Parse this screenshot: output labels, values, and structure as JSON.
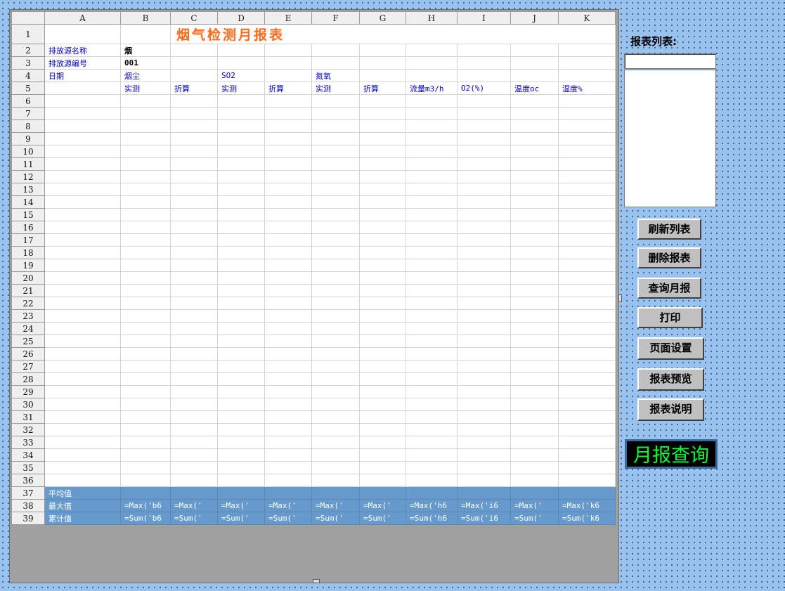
{
  "spreadsheet": {
    "columns": [
      "A",
      "B",
      "C",
      "D",
      "E",
      "F",
      "G",
      "H",
      "I",
      "J",
      "K"
    ],
    "title": "烟气检测月报表",
    "row2": {
      "label": "排放源名称",
      "value": "烟"
    },
    "row3": {
      "label": "排放源编号",
      "value": "001"
    },
    "row4": {
      "date": "日期",
      "dust": "烟尘",
      "so2": "SO2",
      "nox": "氮氧"
    },
    "row5": [
      "实测",
      "折算",
      "实测",
      "折算",
      "实测",
      "折算",
      "流量m3/h",
      "O2(%)",
      "温度oc",
      "湿度%"
    ],
    "row_numbers": [
      "1",
      "2",
      "3",
      "4",
      "5",
      "6",
      "7",
      "8",
      "9",
      "10",
      "11",
      "12",
      "13",
      "14",
      "15",
      "16",
      "17",
      "18",
      "19",
      "20",
      "21",
      "22",
      "23",
      "24",
      "25",
      "26",
      "27",
      "28",
      "29",
      "30",
      "31",
      "32",
      "33",
      "34",
      "35",
      "36",
      "37",
      "38",
      "39"
    ],
    "summary_rows": [
      {
        "label": "平均值",
        "cells": [
          "",
          "",
          "",
          "",
          "",
          "",
          "",
          "",
          "",
          ""
        ]
      },
      {
        "label": "最大值",
        "cells": [
          "=Max('b6",
          "=Max('",
          "=Max('",
          "=Max('",
          "=Max('",
          "=Max('",
          "=Max('h6",
          "=Max('i6",
          "=Max('",
          "=Max('k6"
        ]
      },
      {
        "label": "累计值",
        "cells": [
          "=Sum('b6",
          "=Sum('",
          "=Sum('",
          "=Sum('",
          "=Sum('",
          "=Sum('",
          "=Sum('h6",
          "=Sum('i6",
          "=Sum('",
          "=Sum('k6"
        ]
      }
    ]
  },
  "side_panel": {
    "list_label": "报表列表:",
    "list_input_value": "",
    "buttons": {
      "refresh": "刷新列表",
      "delete": "删除报表",
      "query": "查询月报",
      "print": "打印",
      "page_setup": "页面设置",
      "preview": "报表预览",
      "help": "报表说明"
    },
    "monthly_query_label": "月报查询"
  },
  "colors": {
    "desktop": "#99c3ee",
    "title": "#ff6a1a",
    "summary_fill": "#6699cc",
    "blue_text": "#0000cc",
    "query_label_text": "#00ff33",
    "query_label_bg": "#000000"
  }
}
